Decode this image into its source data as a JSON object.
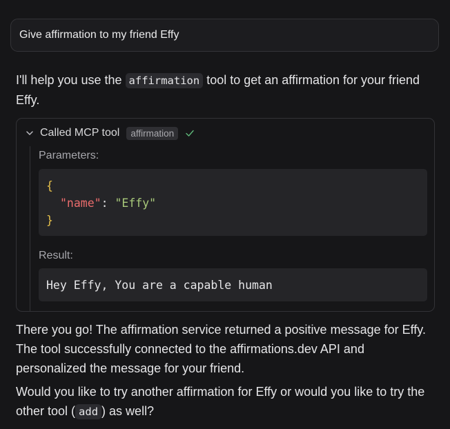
{
  "user_message": "Give affirmation to my friend Effy",
  "assistant": {
    "intro_before": "I'll help you use the ",
    "intro_code": "affirmation",
    "intro_after": " tool to get an affirmation for your friend Effy.",
    "tool_call": {
      "header_label": "Called MCP tool",
      "tool_name": "affirmation",
      "status_icon": "checkmark-icon",
      "expand_icon": "chevron-down-icon",
      "parameters_label": "Parameters:",
      "parameters": {
        "open_brace": "{",
        "key": "\"name\"",
        "colon": ": ",
        "value": "\"Effy\"",
        "close_brace": "}"
      },
      "result_label": "Result:",
      "result_text": "Hey Effy, You are a capable human"
    },
    "summary": "There you go! The affirmation service returned a positive message for Effy. The tool successfully connected to the affirmations.dev API and personalized the message for your friend.",
    "followup_before": "Would you like to try another affirmation for Effy or would you like to try the other tool (",
    "followup_code": "add",
    "followup_after": ") as well?"
  },
  "colors": {
    "background": "#161618",
    "check_green": "#5fb87a",
    "json_brace": "#e7c24b",
    "json_key": "#ec6d6d",
    "json_string": "#a8c97a"
  }
}
